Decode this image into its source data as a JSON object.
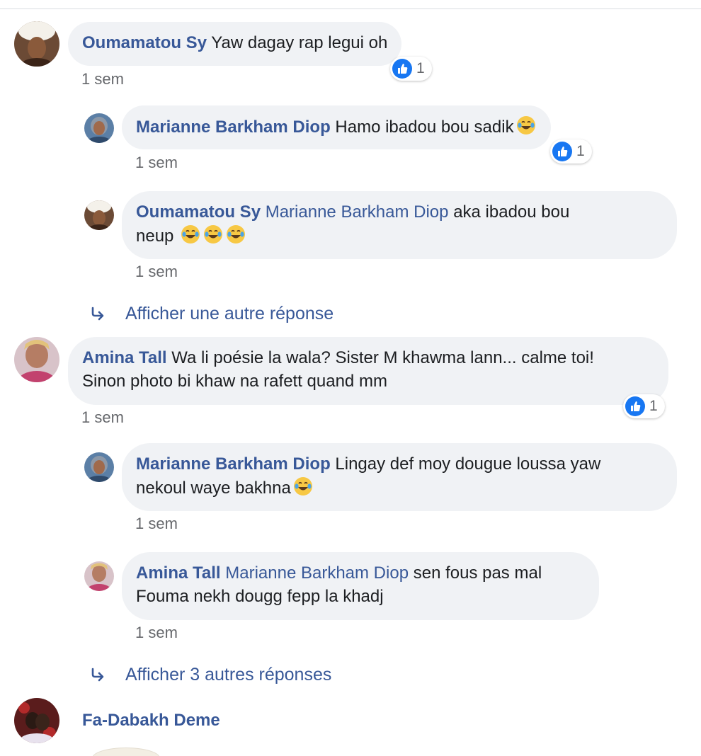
{
  "comments": [
    {
      "author": "Oumamatou Sy",
      "text": "Yaw dagay rap legui oh",
      "time": "1 sem",
      "likes": "1",
      "replies": [
        {
          "author": "Marianne Barkham Diop",
          "text": "Hamo ibadou bou sadik",
          "emoji_count": 1,
          "time": "1 sem",
          "likes": "1"
        },
        {
          "author": "Oumamatou Sy",
          "mention": "Marianne Barkham Diop",
          "text": "aka ibadou bou",
          "text_line2": "neup",
          "emoji_count": 3,
          "time": "1 sem"
        }
      ],
      "more_replies_label": "Afficher une autre réponse"
    },
    {
      "author": "Amina Tall",
      "text": "Wa li poésie la wala? Sister M khawma lann... calme toi!",
      "text_line2": "Sinon photo bi khaw na rafett quand mm",
      "time": "1 sem",
      "likes": "1",
      "replies": [
        {
          "author": "Marianne Barkham Diop",
          "text": "Lingay def moy dougue loussa yaw",
          "text_line2": "nekoul waye bakhna",
          "emoji_count": 1,
          "time": "1 sem"
        },
        {
          "author": "Amina Tall",
          "mention": "Marianne Barkham Diop",
          "text": "sen fous pas mal",
          "text_line2": "Fouma nekh dougg fepp la khadj",
          "time": "1 sem"
        }
      ],
      "more_replies_label": "Afficher 3 autres réponses"
    },
    {
      "author": "Fa-Dabakh Deme"
    }
  ],
  "icons": {
    "reaction": "like-thumb-icon",
    "reply": "reply-arrow-icon",
    "emoji": "tears-of-joy-emoji"
  },
  "colors": {
    "link": "#385898",
    "bubble": "#f0f2f5",
    "meta": "#65676b",
    "like": "#1877f2"
  }
}
